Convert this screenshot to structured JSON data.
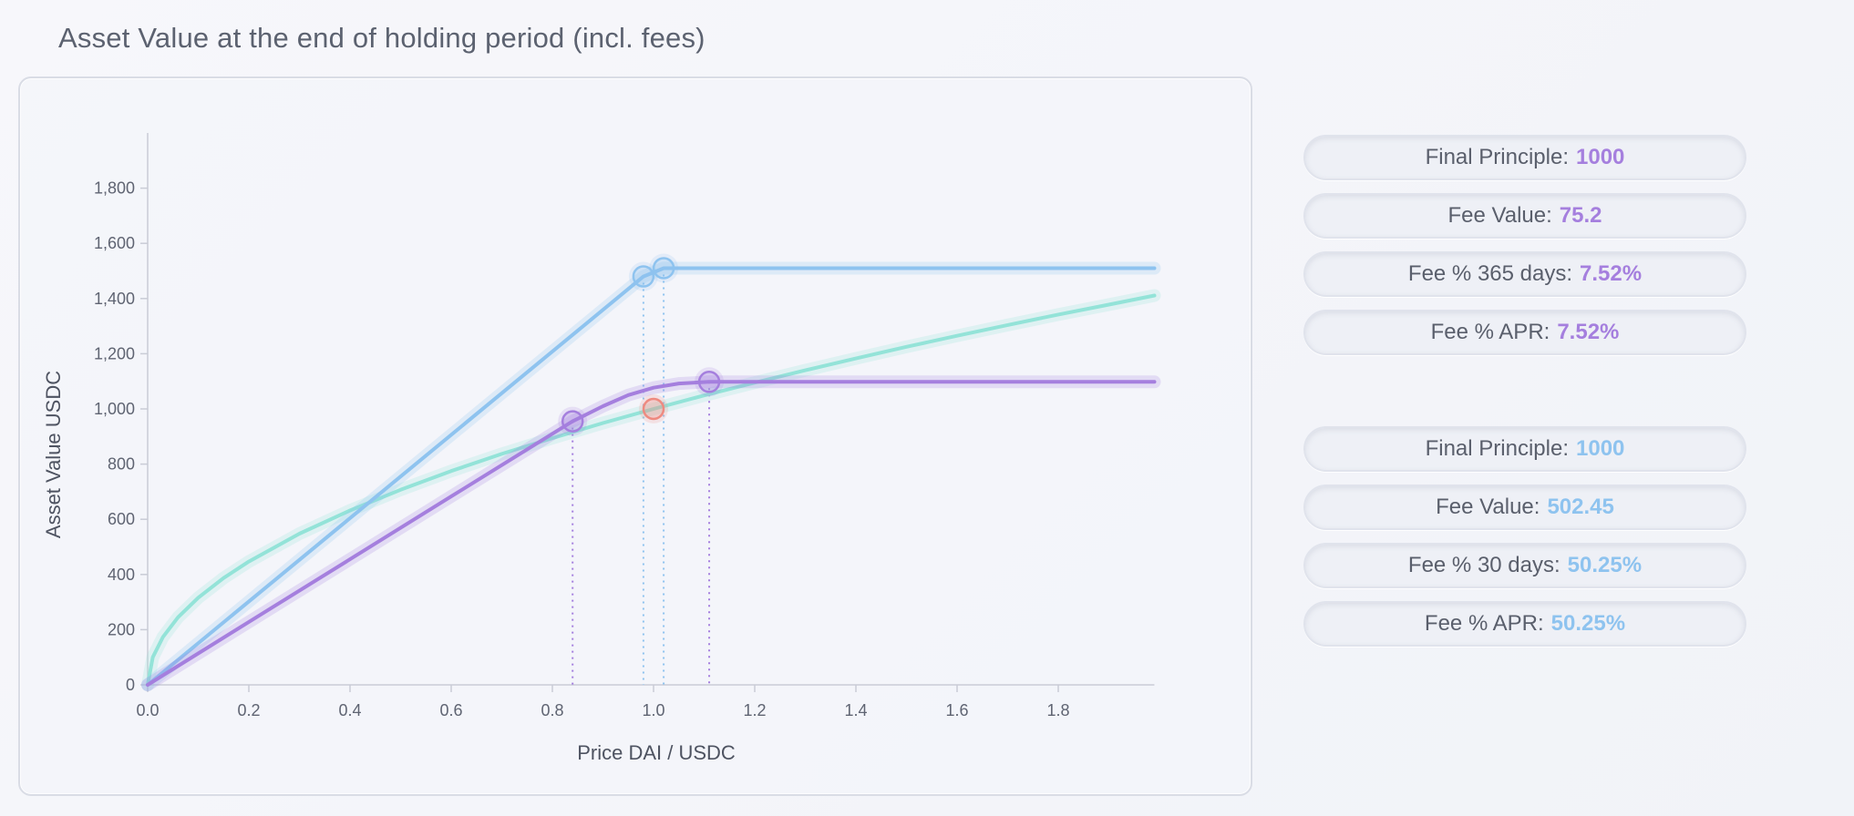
{
  "page": {
    "title": "Asset Value at the end of holding period  (incl. fees)"
  },
  "colors": {
    "purple": "#a57fde",
    "blue": "#8ec3ef",
    "teal": "#93e3d8",
    "red": "#ee8a80"
  },
  "stats_a": {
    "accent": "#a57fde",
    "items": [
      {
        "label": "Final Principle:",
        "value": "1000"
      },
      {
        "label": "Fee Value:",
        "value": "75.2"
      },
      {
        "label": "Fee % 365 days:",
        "value": "7.52%"
      },
      {
        "label": "Fee % APR:",
        "value": "7.52%"
      }
    ]
  },
  "stats_b": {
    "accent": "#8ec3ef",
    "items": [
      {
        "label": "Final Principle:",
        "value": "1000"
      },
      {
        "label": "Fee Value:",
        "value": "502.45"
      },
      {
        "label": "Fee % 30 days:",
        "value": "50.25%"
      },
      {
        "label": "Fee % APR:",
        "value": "50.25%"
      }
    ]
  },
  "chart_data": {
    "type": "line",
    "title": "",
    "xlabel": "Price DAI / USDC",
    "ylabel": "Asset Value USDC",
    "xlim": [
      0,
      2.0
    ],
    "ylim": [
      0,
      2000
    ],
    "xticks": [
      0.0,
      0.2,
      0.4,
      0.6,
      0.8,
      1.0,
      1.2,
      1.4,
      1.6,
      1.8
    ],
    "xtick_labels": [
      "0.0",
      "0.2",
      "0.4",
      "0.6",
      "0.8",
      "1.0",
      "1.2",
      "1.4",
      "1.6",
      "1.8"
    ],
    "yticks": [
      0,
      200,
      400,
      600,
      800,
      1000,
      1200,
      1400,
      1600,
      1800
    ],
    "ytick_labels": [
      "0",
      "200",
      "400",
      "600",
      "800",
      "1,000",
      "1,200",
      "1,400",
      "1,600",
      "1,800"
    ],
    "grid": false,
    "series": [
      {
        "color": "#93e3d8",
        "x": [
          0,
          0.01,
          0.03,
          0.06,
          0.1,
          0.15,
          0.2,
          0.3,
          0.4,
          0.5,
          0.6,
          0.7,
          0.8,
          0.9,
          1.0,
          1.1,
          1.2,
          1.3,
          1.4,
          1.5,
          1.6,
          1.7,
          1.8,
          1.9,
          1.99
        ],
        "y": [
          0,
          100,
          173,
          245,
          316,
          387,
          447,
          548,
          632,
          707,
          775,
          837,
          894,
          949,
          1000,
          1049,
          1095,
          1140,
          1183,
          1225,
          1265,
          1304,
          1342,
          1378,
          1411
        ]
      },
      {
        "color": "#8ec3ef",
        "x": [
          0,
          0.98,
          1.02,
          1.99
        ],
        "y": [
          0,
          1480,
          1510,
          1510
        ]
      },
      {
        "color": "#a57fde",
        "x": [
          0,
          0.2,
          0.4,
          0.6,
          0.8,
          0.84,
          0.9,
          0.95,
          1.0,
          1.05,
          1.11,
          1.3,
          1.6,
          1.99
        ],
        "y": [
          0,
          228,
          455,
          683,
          910,
          955,
          1010,
          1050,
          1077,
          1092,
          1098,
          1098,
          1098,
          1098
        ]
      }
    ],
    "markers": [
      {
        "x": 0.84,
        "y": 955,
        "color": "#a57fde",
        "guide": true
      },
      {
        "x": 0.98,
        "y": 1480,
        "color": "#8ec3ef",
        "guide": true
      },
      {
        "x": 1.02,
        "y": 1510,
        "color": "#8ec3ef",
        "guide": true
      },
      {
        "x": 1.11,
        "y": 1098,
        "color": "#a57fde",
        "guide": true
      },
      {
        "x": 1.0,
        "y": 1000,
        "color": "#ee8a80",
        "guide": false
      }
    ]
  }
}
